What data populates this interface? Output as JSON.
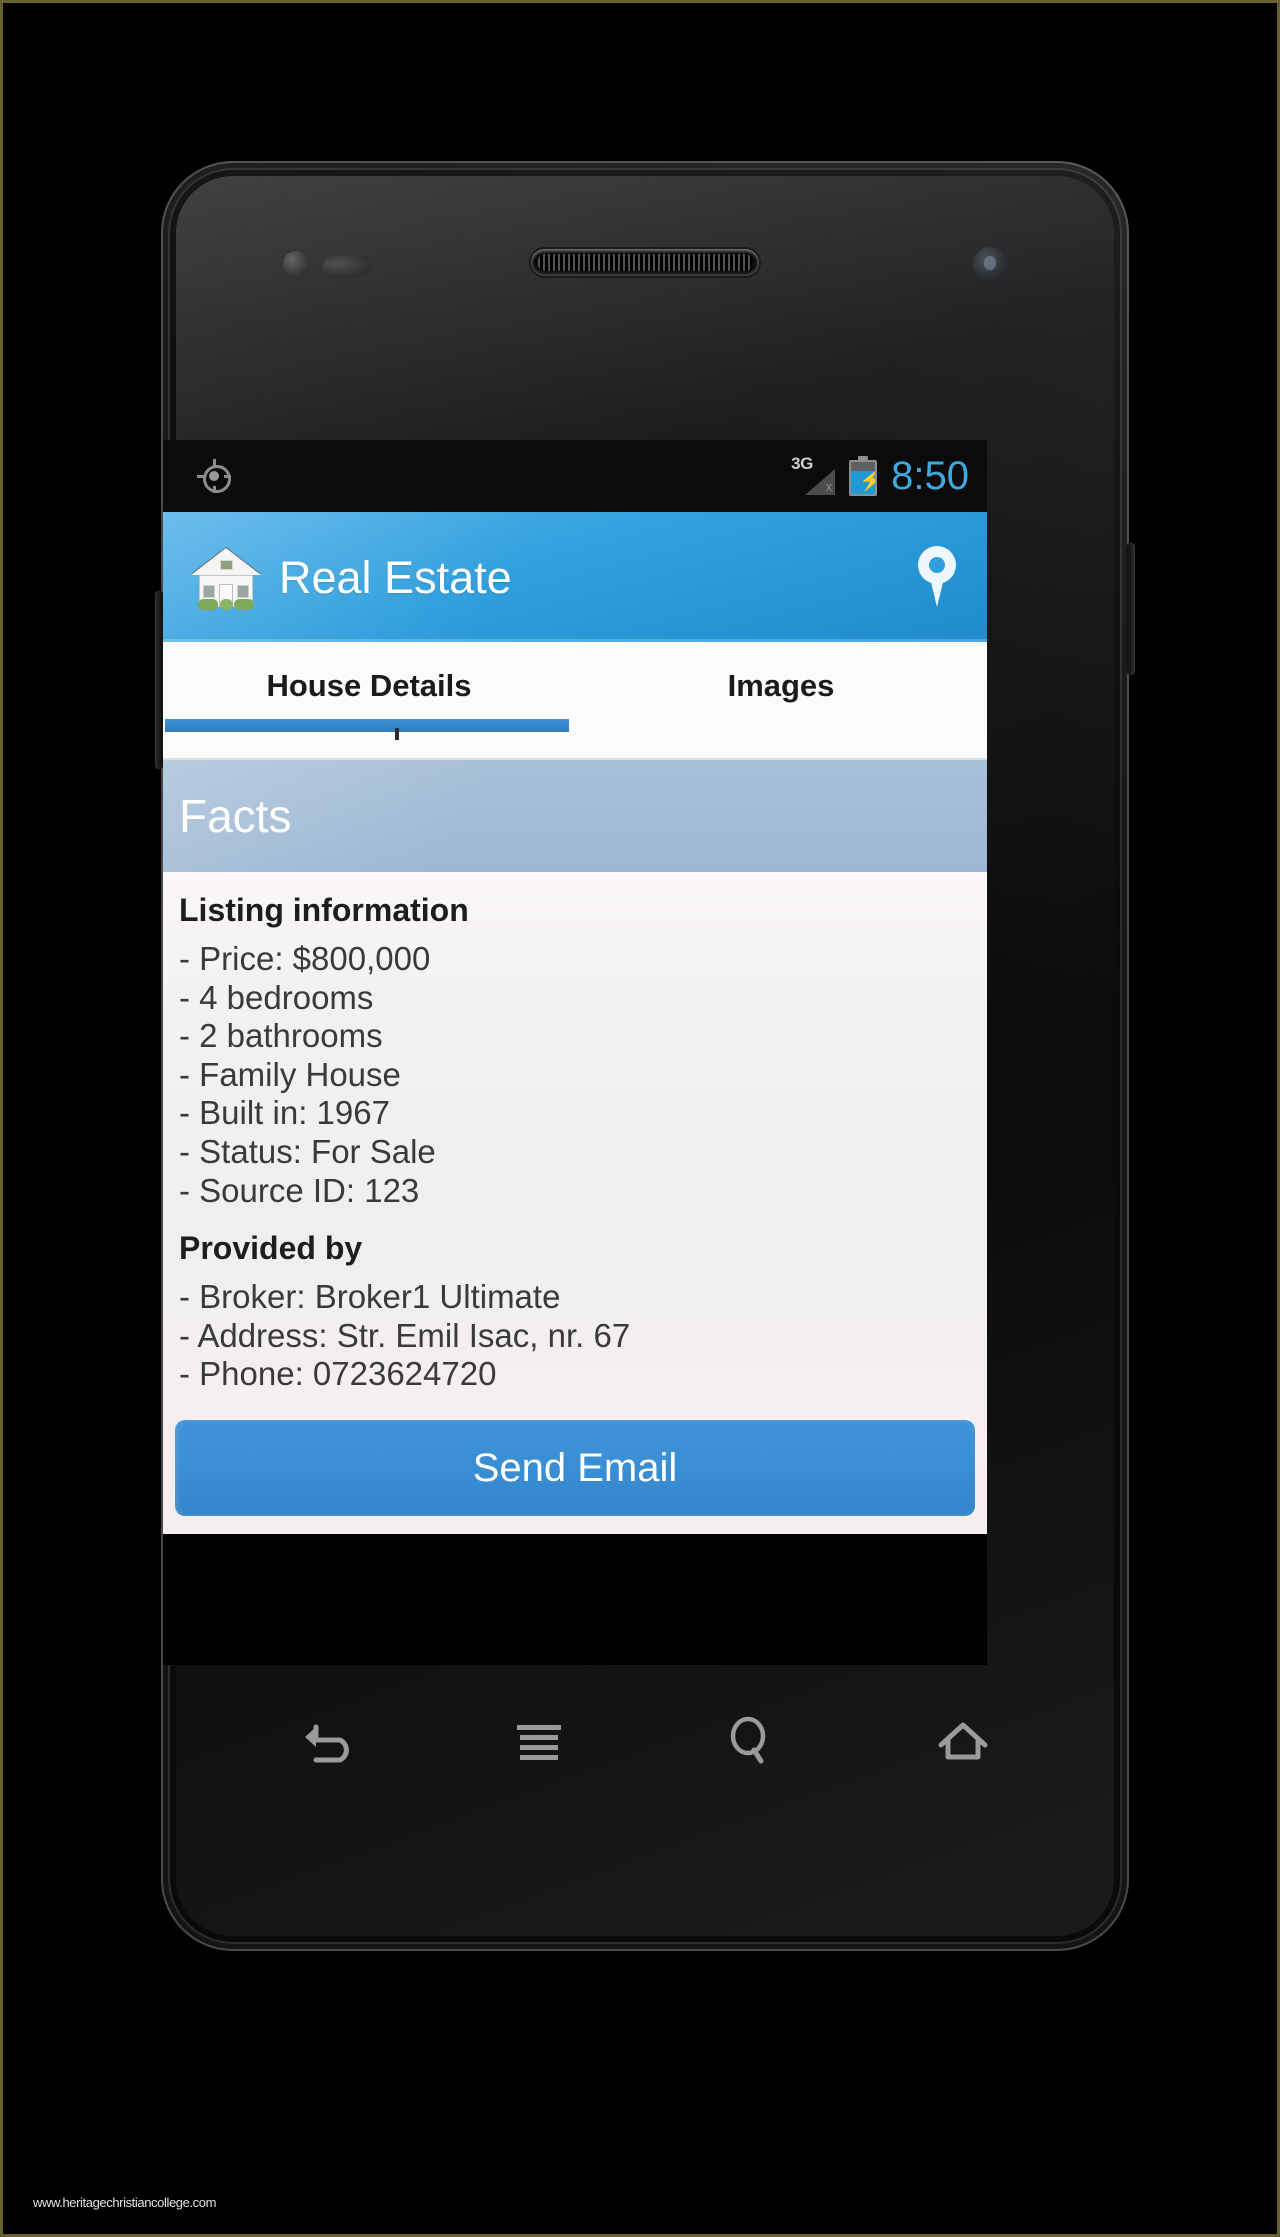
{
  "statusbar": {
    "gps_icon": "gps-crosshair-icon",
    "network_label": "3G",
    "signal_state": "x",
    "battery_icon": "battery-charging-icon",
    "time": "8:50"
  },
  "appbar": {
    "house_icon": "house-icon",
    "title": "Real Estate",
    "pin_icon": "map-pin-icon"
  },
  "tabs": [
    {
      "label": "House Details",
      "active": true
    },
    {
      "label": "Images",
      "active": false
    }
  ],
  "facts": {
    "section_title": "Facts",
    "groups": [
      {
        "title": "Listing information",
        "items": [
          "- Price: $800,000",
          "- 4 bedrooms",
          "- 2 bathrooms",
          "- Family House",
          "- Built in: 1967",
          "- Status: For Sale",
          "- Source ID: 123"
        ]
      },
      {
        "title": "Provided by",
        "items": [
          "- Broker: Broker1 Ultimate",
          "- Address: Str. Emil Isac, nr. 67",
          "- Phone: 0723624720"
        ]
      }
    ]
  },
  "actions": {
    "send_email_label": "Send Email"
  },
  "navbar": [
    {
      "name": "back-icon"
    },
    {
      "name": "menu-icon"
    },
    {
      "name": "search-icon"
    },
    {
      "name": "home-icon"
    }
  ],
  "watermark": "www.heritagechristiancollege.com",
  "colors": {
    "accent_blue": "#2f9fdd",
    "button_blue": "#3a8ed4",
    "facts_band": "#a2bcd6",
    "clock_blue": "#3ea9e0",
    "tab_underline": "#3c93d8"
  }
}
